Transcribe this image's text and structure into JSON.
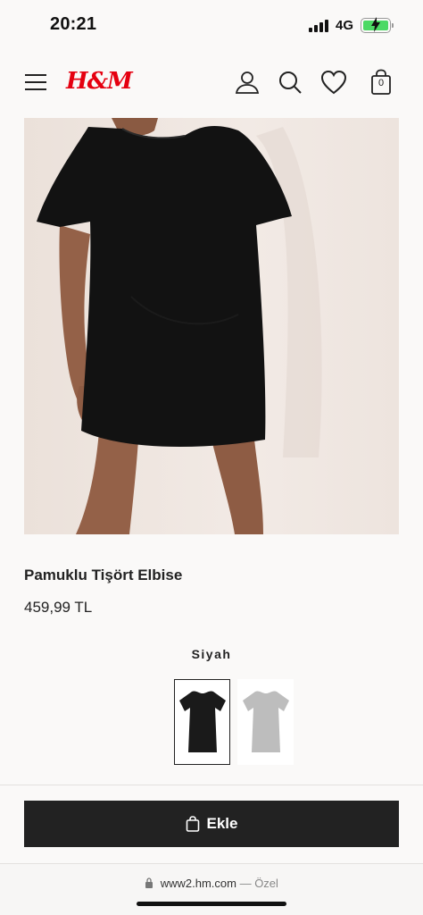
{
  "status_bar": {
    "time": "20:21",
    "network": "4G",
    "signal_icon": "cellular-signal-icon",
    "battery_icon": "battery-charging-icon"
  },
  "header": {
    "brand": "H&M",
    "brand_color": "#e50010",
    "cart_count": "0",
    "icons": [
      "menu-icon",
      "account-icon",
      "search-icon",
      "favorites-icon",
      "shopping-bag-icon"
    ]
  },
  "product": {
    "name": "Pamuklu Tişört Elbise",
    "price": "459,99 TL",
    "image_icon": "product-photo-black-tshirt-dress"
  },
  "color_selector": {
    "selected_color": "Siyah",
    "options": [
      {
        "color": "#1a1a1a",
        "selected": true
      },
      {
        "color": "#bdbdbd",
        "selected": false
      }
    ]
  },
  "add_to_bag": {
    "label": "Ekle",
    "icon": "shopping-bag-icon"
  },
  "browser": {
    "url": "www2.hm.com",
    "mode": "— Özel",
    "icon": "lock-icon"
  }
}
